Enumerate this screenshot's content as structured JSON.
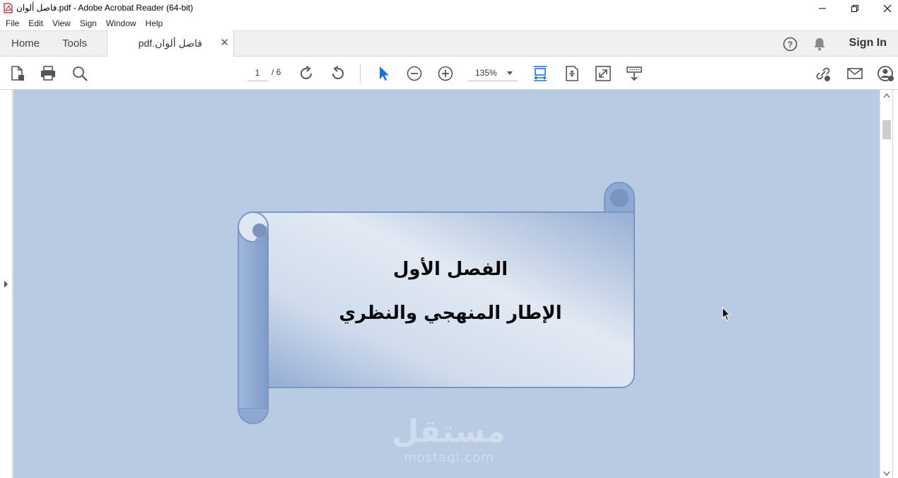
{
  "window": {
    "title": "فاصل ألوان.pdf - Adobe Acrobat Reader (64-bit)"
  },
  "menu": [
    "File",
    "Edit",
    "View",
    "Sign",
    "Window",
    "Help"
  ],
  "tabs": {
    "home": "Home",
    "tools": "Tools",
    "document": "فاصل ألوان.pdf",
    "sign_in": "Sign In"
  },
  "toolbar": {
    "current_page": "1",
    "total_pages": "/ 6",
    "zoom": "135%"
  },
  "document": {
    "heading": "الفصل الأول",
    "subheading": "الإطار المنهجي والنظري",
    "page_color": "#b8cbe3"
  },
  "watermark": {
    "arabic": "مستقل",
    "latin": "mostaql.com"
  },
  "icons": [
    "acrobat-icon",
    "minimize-icon",
    "restore-icon",
    "close-icon",
    "help-icon",
    "bell-icon",
    "create-pdf-icon",
    "print-icon",
    "search-icon",
    "page-up-icon",
    "page-down-icon",
    "select-cursor-icon",
    "zoom-out-icon",
    "zoom-in-icon",
    "fit-width-icon",
    "fit-page-icon",
    "full-screen-icon",
    "read-mode-icon",
    "share-link-icon",
    "email-icon",
    "add-user-icon"
  ]
}
